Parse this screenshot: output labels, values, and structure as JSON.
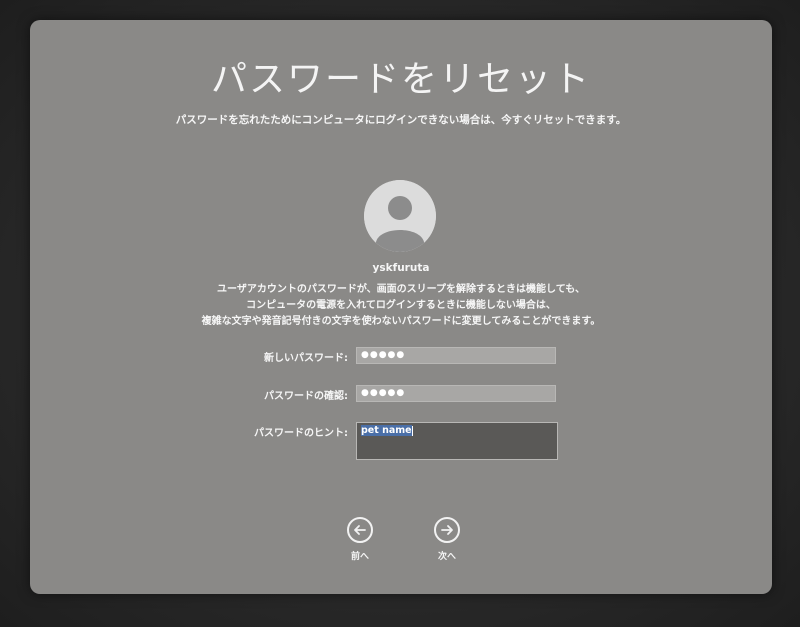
{
  "window": {
    "title": "パスワードをリセット",
    "subtitle": "パスワードを忘れたためにコンピュータにログインできない場合は、今すぐリセットできます。"
  },
  "user": {
    "avatar_icon": "person-silhouette-icon",
    "username": "yskfuruta"
  },
  "notice": {
    "line1": "ユーザアカウントのパスワードが、画面のスリープを解除するときは機能しても、",
    "line2": "コンピュータの電源を入れてログインするときに機能しない場合は、",
    "line3": "複雑な文字や発音記号付きの文字を使わないパスワードに変更してみることができます。"
  },
  "form": {
    "new_password_label": "新しいパスワード:",
    "new_password_value": "●●●●●",
    "verify_label": "パスワードの確認:",
    "verify_value": "●●●●●",
    "hint_label": "パスワードのヒント:",
    "hint_value": "pet name"
  },
  "nav": {
    "back_label": "前へ",
    "back_icon": "arrow-left-circle-icon",
    "next_label": "次へ",
    "next_icon": "arrow-right-circle-icon"
  },
  "colors": {
    "panel": "#8a8987",
    "field": "#a8a7a5",
    "hint_field": "#5a5957",
    "selection": "#4a6fa8"
  }
}
